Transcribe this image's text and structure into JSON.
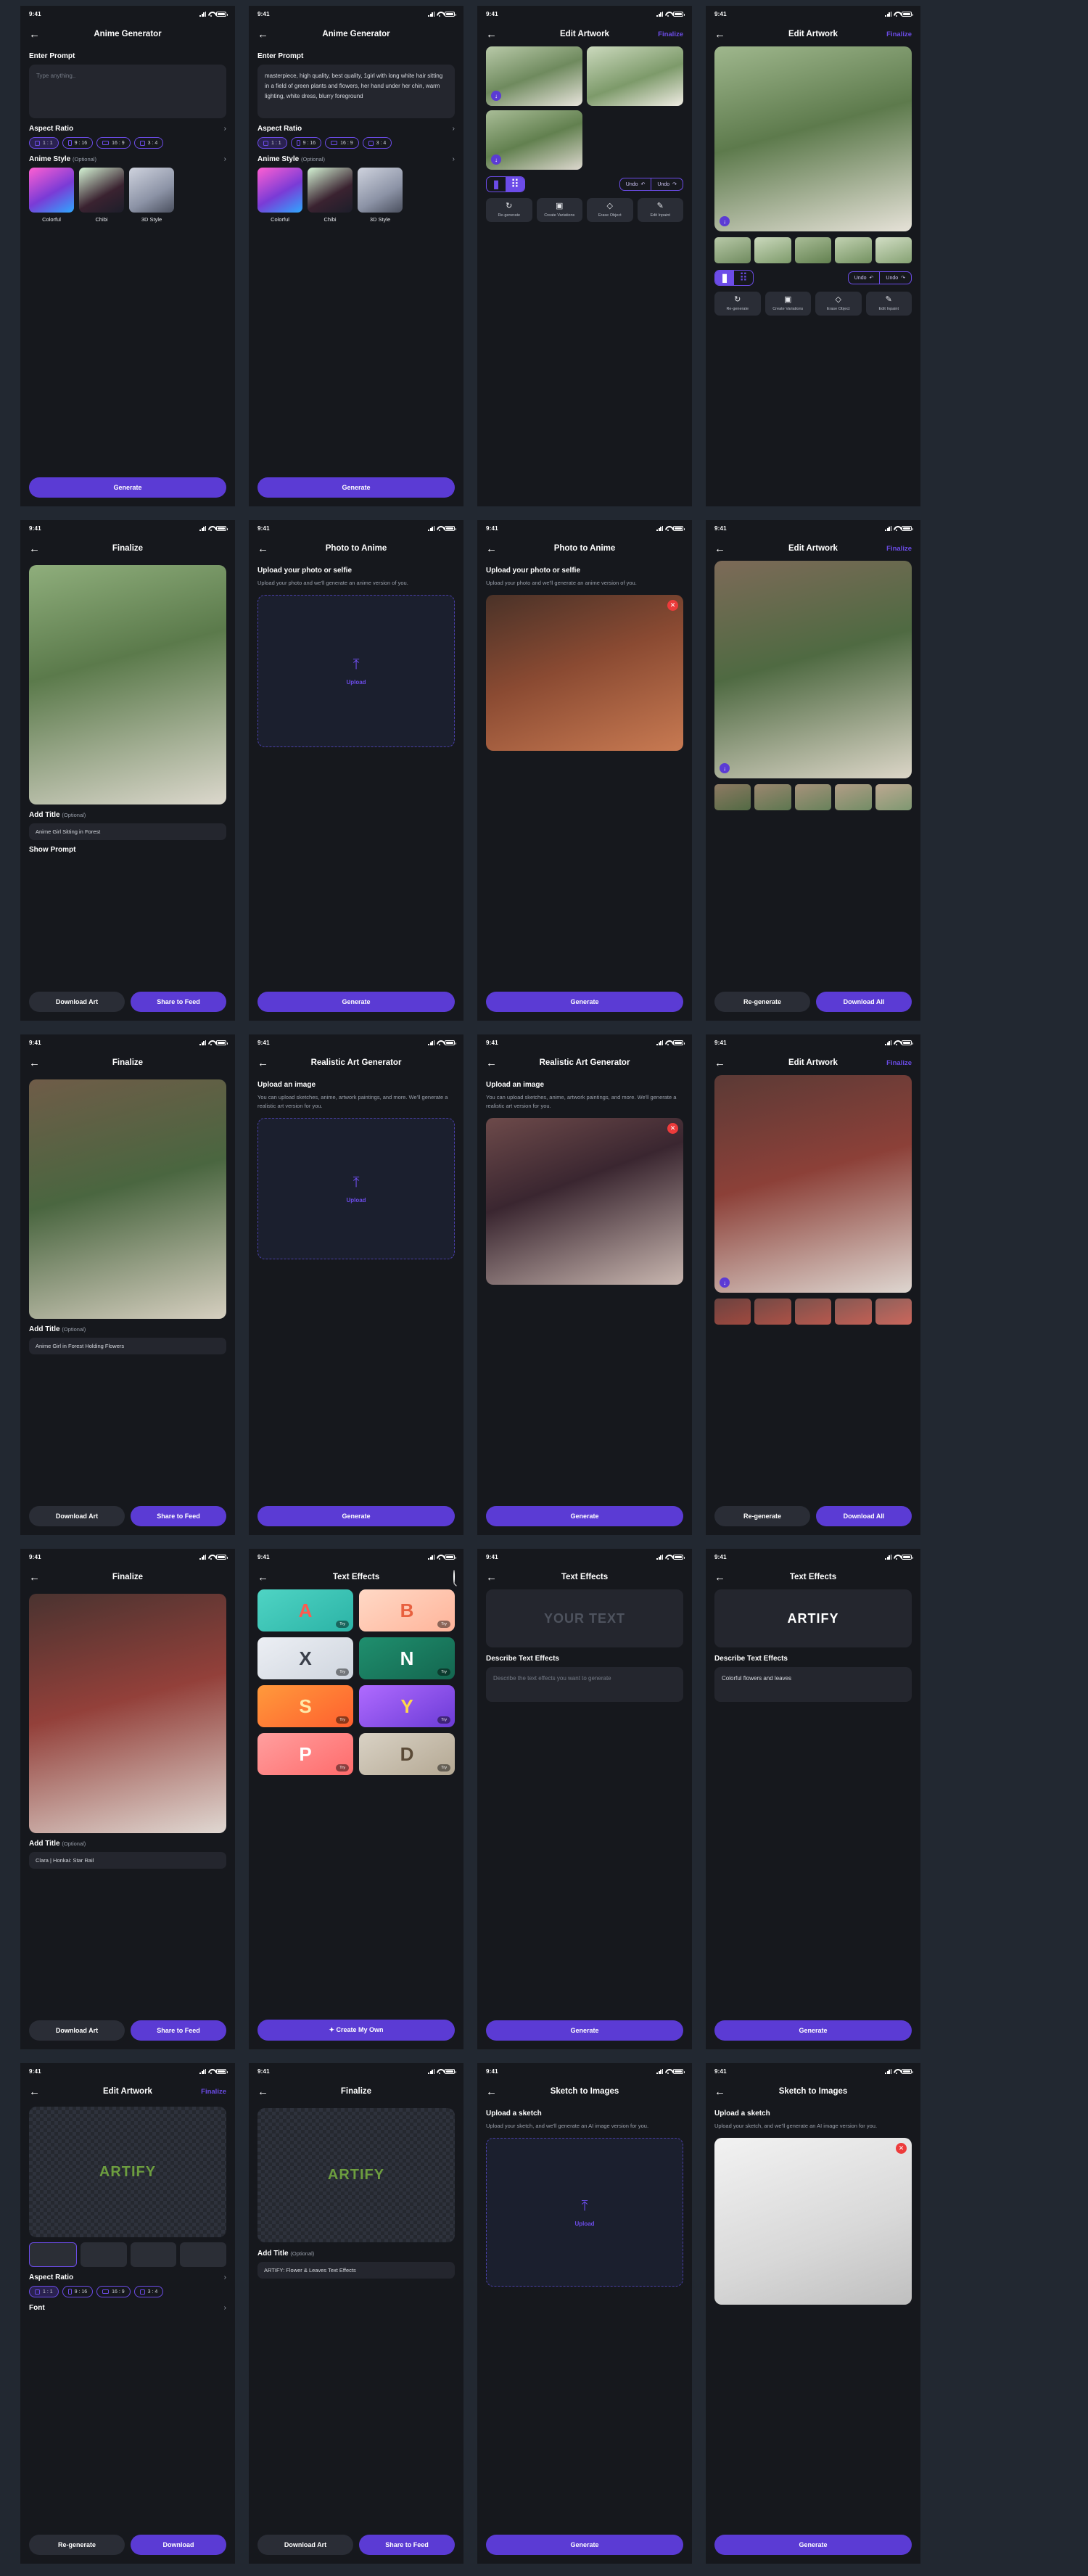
{
  "meta": {
    "status_time": "9:41",
    "accent": "#5B3BD4",
    "accent_border": "#6C4CE8",
    "danger": "#ED3B3B"
  },
  "common": {
    "back_icon": "←",
    "optional": "(Optional)",
    "generate": "Generate",
    "finalize": "Finalize",
    "download_art": "Download Art",
    "share_to_feed": "Share to Feed",
    "download_all": "Download All",
    "re_generate": "Re-generate",
    "download": "Download",
    "upload": "Upload",
    "add_title": "Add Title",
    "undo": "Undo",
    "chevron": "›"
  },
  "aspect_ratio": {
    "label": "Aspect Ratio",
    "options": [
      {
        "label": "1 : 1",
        "shape": "square"
      },
      {
        "label": "9 : 16",
        "shape": "portrait"
      },
      {
        "label": "16 : 9",
        "shape": "landscape"
      },
      {
        "label": "3 : 4",
        "shape": "square"
      }
    ],
    "selected": "1 : 1"
  },
  "anime_style": {
    "label": "Anime Style",
    "items": [
      {
        "name": "Colorful",
        "color": "linear-gradient(150deg,#ff5fd2,#7a3bd6 55%,#2ea8ff)"
      },
      {
        "name": "Chibi",
        "color": "linear-gradient(150deg,#d6f5d6,#3a2230 60%,#1c1e2a)"
      },
      {
        "name": "3D Style",
        "color": "linear-gradient(150deg,#cfd3de,#8c93a6 60%,#4a4f5e)"
      }
    ]
  },
  "screens": [
    {
      "id": "anime-generator-empty",
      "title": "Anime Generator",
      "prompt_label": "Enter Prompt",
      "prompt_placeholder": "Type anything..",
      "prompt_value": ""
    },
    {
      "id": "anime-generator-filled",
      "title": "Anime Generator",
      "prompt_label": "Enter Prompt",
      "prompt_placeholder": "Type anything..",
      "prompt_value": "masterpiece, high quality, best quality, 1girl with long white hair sitting in a field of green plants and flowers, her hand under her chin, warm lighting, white dress, blurry foreground"
    },
    {
      "id": "edit-artwork-grid",
      "title": "Edit Artwork",
      "action": "Finalize",
      "view_mode": "grid",
      "undo_label": "Undo",
      "redo_label": "Undo",
      "tools": [
        {
          "label": "Re-generate",
          "icon": "↻"
        },
        {
          "label": "Create Variations",
          "icon": "▣"
        },
        {
          "label": "Erase Object",
          "icon": "◇"
        },
        {
          "label": "Edit Inpaint",
          "icon": "✎"
        }
      ]
    },
    {
      "id": "edit-artwork-single",
      "title": "Edit Artwork",
      "action": "Finalize",
      "view_mode": "single",
      "undo_label": "Undo",
      "redo_label": "Undo",
      "tools": [
        {
          "label": "Re-generate",
          "icon": "↻"
        },
        {
          "label": "Create Variations",
          "icon": "▣"
        },
        {
          "label": "Erase Object",
          "icon": "◇"
        },
        {
          "label": "Edit Inpaint",
          "icon": "✎"
        }
      ]
    },
    {
      "id": "finalize-anime-girl",
      "title": "Finalize",
      "title_label": "Add Title",
      "title_value": "Anime Girl Sitting in Forest",
      "second_label": "Show Prompt"
    },
    {
      "id": "photo-to-anime-empty",
      "title": "Photo to Anime",
      "heading": "Upload your photo or selfie",
      "helper": "Upload your photo and we'll generate an anime version of you.",
      "state": "empty"
    },
    {
      "id": "photo-to-anime-filled",
      "title": "Photo to Anime",
      "heading": "Upload your photo or selfie",
      "helper": "Upload your photo and we'll generate an anime version of you.",
      "state": "filled"
    },
    {
      "id": "edit-artwork-photo",
      "title": "Edit Artwork",
      "action": "Finalize"
    },
    {
      "id": "finalize-forest-flowers",
      "title": "Finalize",
      "title_label": "Add Title",
      "title_value": "Anime Girl in Forest Holding Flowers"
    },
    {
      "id": "realistic-art-empty",
      "title": "Realistic Art Generator",
      "heading": "Upload an image",
      "helper": "You can upload sketches, anime, artwork paintings, and more. We'll generate a realistic art version for you.",
      "state": "empty"
    },
    {
      "id": "realistic-art-filled",
      "title": "Realistic Art Generator",
      "heading": "Upload an image",
      "helper": "You can upload sketches, anime, artwork paintings, and more. We'll generate a realistic art version for you.",
      "state": "filled"
    },
    {
      "id": "edit-artwork-realistic",
      "title": "Edit Artwork",
      "action": "Finalize"
    },
    {
      "id": "finalize-honkai",
      "title": "Finalize",
      "title_label": "Add Title",
      "title_value": "Clara | Honkai: Star Rail"
    },
    {
      "id": "text-effects-gallery",
      "title": "Text Effects",
      "search_icon": "search-icon",
      "create_own": "Create My Own",
      "cards": [
        {
          "word": "A",
          "try": "Try",
          "bg": "linear-gradient(150deg,#4fd4c4,#2bb3a6)",
          "fg": "#ff5a4e"
        },
        {
          "word": "B",
          "try": "Try",
          "bg": "linear-gradient(150deg,#ffd9c6,#ffb49a)",
          "fg": "#e8603f"
        },
        {
          "word": "X",
          "try": "Try",
          "bg": "linear-gradient(150deg,#eceff4,#cfd5de)",
          "fg": "#3a3f4a"
        },
        {
          "word": "N",
          "try": "Try",
          "bg": "linear-gradient(150deg,#1f8f6e,#14664f)",
          "fg": "#ffffff"
        },
        {
          "word": "S",
          "try": "Try",
          "bg": "linear-gradient(150deg,#ff9a3c,#ff5f2e)",
          "fg": "#ffe9a8"
        },
        {
          "word": "Y",
          "try": "Try",
          "bg": "linear-gradient(150deg,#b06bff,#6b3bd6)",
          "fg": "#ffd94a"
        },
        {
          "word": "P",
          "try": "Try",
          "bg": "linear-gradient(150deg,#ff9f9f,#ff6b6b)",
          "fg": "#ffffff"
        },
        {
          "word": "D",
          "try": "Try",
          "bg": "linear-gradient(150deg,#d9d2c5,#b4a893)",
          "fg": "#5a4a36"
        }
      ]
    },
    {
      "id": "text-effects-empty",
      "title": "Text Effects",
      "preview_placeholder": "YOUR TEXT",
      "describe_label": "Describe Text Effects",
      "describe_placeholder": "Describe the text effects you want to generate",
      "describe_value": ""
    },
    {
      "id": "text-effects-filled",
      "title": "Text Effects",
      "preview_value": "ARTIFY",
      "describe_label": "Describe Text Effects",
      "describe_placeholder": "Describe the text effects you want to generate",
      "describe_value": "Colorful flowers and leaves"
    },
    {
      "id": "edit-artwork-text",
      "title": "Edit Artwork",
      "action": "Finalize",
      "word": "ARTIFY",
      "font_label": "Font"
    },
    {
      "id": "finalize-text",
      "title": "Finalize",
      "title_label": "Add Title",
      "title_value": "ARTIFY: Flower & Leaves Text Effects",
      "word": "ARTIFY"
    },
    {
      "id": "sketch-to-images-empty",
      "title": "Sketch to Images",
      "heading": "Upload a sketch",
      "helper": "Upload your sketch, and we'll generate an AI image version for you.",
      "state": "empty"
    },
    {
      "id": "sketch-to-images-filled",
      "title": "Sketch to Images",
      "heading": "Upload a sketch",
      "helper": "Upload your sketch, and we'll generate an AI image version for you.",
      "state": "filled"
    }
  ]
}
